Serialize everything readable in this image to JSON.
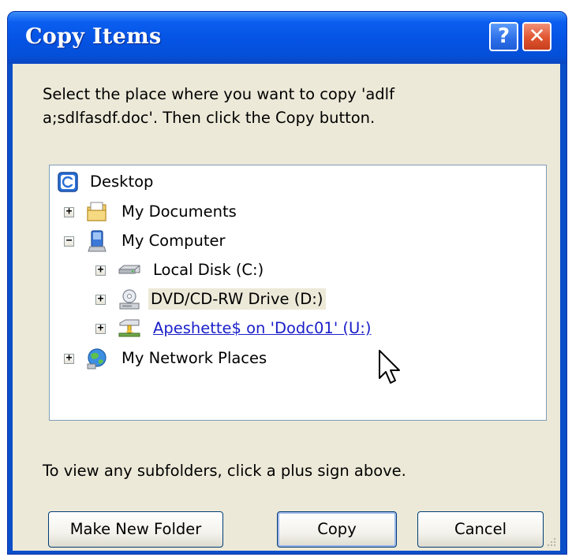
{
  "window": {
    "title": "Copy Items",
    "help_glyph": "?",
    "close_glyph": "✕"
  },
  "instructions": {
    "line1": "Select the place where you want to copy 'adlf",
    "line2": "a;sdlfasdf.doc'. Then click the Copy button."
  },
  "tree": {
    "nodes": [
      {
        "label": "Desktop",
        "icon": "desktop-icon",
        "expander": ""
      },
      {
        "label": "My Documents",
        "icon": "my-documents-icon",
        "expander": "+"
      },
      {
        "label": "My Computer",
        "icon": "my-computer-icon",
        "expander": "−"
      },
      {
        "label": "Local Disk (C:)",
        "icon": "hard-disk-icon",
        "expander": "+"
      },
      {
        "label": "DVD/CD-RW Drive (D:)",
        "icon": "dvd-drive-icon",
        "expander": "+"
      },
      {
        "label": "Apeshette$ on 'Dodc01' (U:)",
        "icon": "network-drive-icon",
        "expander": "+"
      },
      {
        "label": "My Network Places",
        "icon": "network-places-icon",
        "expander": "+"
      }
    ]
  },
  "hint": "To view any subfolders, click a plus sign above.",
  "buttons": {
    "make_new_folder": "Make New Folder",
    "copy": "Copy",
    "cancel": "Cancel"
  },
  "colors": {
    "titlebar": "#0553e3",
    "client": "#ece9d8",
    "link": "#1a1fc9",
    "close": "#e0542f"
  }
}
